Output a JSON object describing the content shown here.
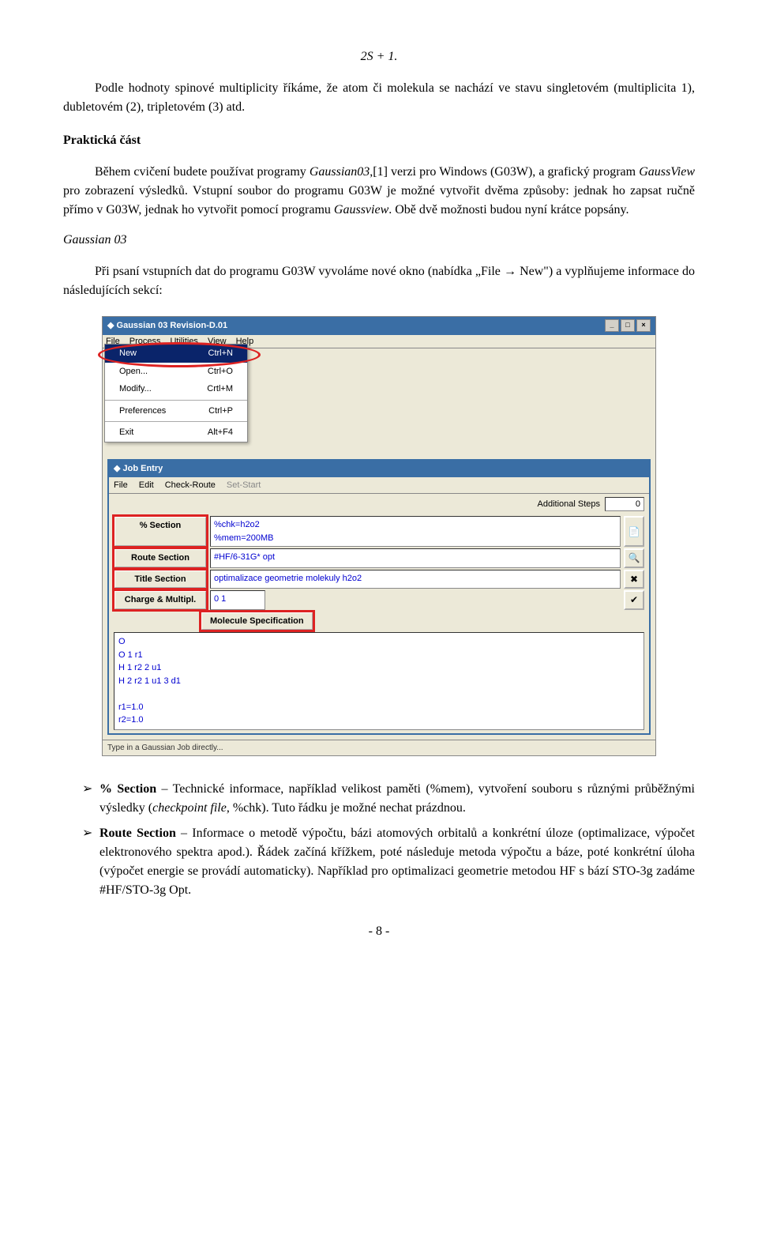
{
  "formula": "2S + 1.",
  "para1": "Podle hodnoty spinové multiplicity říkáme, že atom či molekula se nachází ve stavu singletovém (multiplicita 1), dubletovém (2), tripletovém (3) atd.",
  "section_heading": "Praktická část",
  "para2_a": "Během cvičení budete používat programy ",
  "para2_gauss": "Gaussian03",
  "para2_b": ",[1] verzi pro Windows (G03W), a grafický program ",
  "para2_gview": "GaussView",
  "para2_c": " pro zobrazení výsledků. Vstupní soubor do programu G03W je možné vytvořit dvěma způsoby: jednak ho zapsat ručně přímo v G03W, jednak ho vytvořit pomocí programu ",
  "para2_gview2": "Gaussview",
  "para2_d": ". Obě dvě možnosti budou nyní krátce popsány.",
  "subheading": "Gaussian 03",
  "para3": "Při psaní vstupních dat do programu G03W vyvoláme nové okno (nabídka „File → New\") a vyplňujeme informace do následujících sekcí:",
  "app": {
    "window_title": "Gaussian 03 Revision-D.01",
    "menubar": [
      "File",
      "Process",
      "Utilities",
      "View",
      "Help"
    ],
    "file_menu": {
      "new": "New",
      "new_sc": "Ctrl+N",
      "open": "Open...",
      "open_sc": "Ctrl+O",
      "modify": "Modify...",
      "modify_sc": "Crtl+M",
      "prefs": "Preferences",
      "prefs_sc": "Ctrl+P",
      "exit": "Exit",
      "exit_sc": "Alt+F4"
    },
    "child_title": "Job Entry",
    "child_menu": [
      "File",
      "Edit",
      "Check-Route",
      "Set-Start"
    ],
    "addsteps_label": "Additional Steps",
    "addsteps_value": "0",
    "sections": {
      "pct_label": "% Section",
      "pct_value1": "%chk=h2o2",
      "pct_value2": "%mem=200MB",
      "route_label": "Route Section",
      "route_value": "#HF/6-31G* opt",
      "title_label": "Title Section",
      "title_value": "optimalizace geometrie molekuly h2o2",
      "charge_label": "Charge & Multipl.",
      "charge_value": "0 1",
      "molspec_label": "Molecule Specification"
    },
    "molspec_text": "O\nO 1 r1\nH 1 r2 2 u1\nH 2 r2 1 u1 3 d1\n\nr1=1.0\nr2=1.0",
    "statusbar": "Type in a Gaussian Job directly..."
  },
  "bullets": {
    "b1_head": "% Section",
    "b1_text": " – Technické informace, například velikost paměti (%mem), vytvoření souboru s různými průběžnými výsledky (",
    "b1_it": "checkpoint file",
    "b1_text2": ", %chk). Tuto řádku je možné nechat prázdnou.",
    "b2_head": "Route Section",
    "b2_text": " – Informace o metodě výpočtu, bázi atomových orbitalů a konkrétní úloze (optimalizace, výpočet elektronového spektra apod.). Řádek začíná křížkem, poté následuje metoda výpočtu a báze, poté konkrétní úloha (výpočet energie se provádí automaticky). Například pro optimalizaci geometrie metodou HF s bází STO-3g zadáme #HF/STO-3g Opt."
  },
  "page_number": "- 8 -"
}
